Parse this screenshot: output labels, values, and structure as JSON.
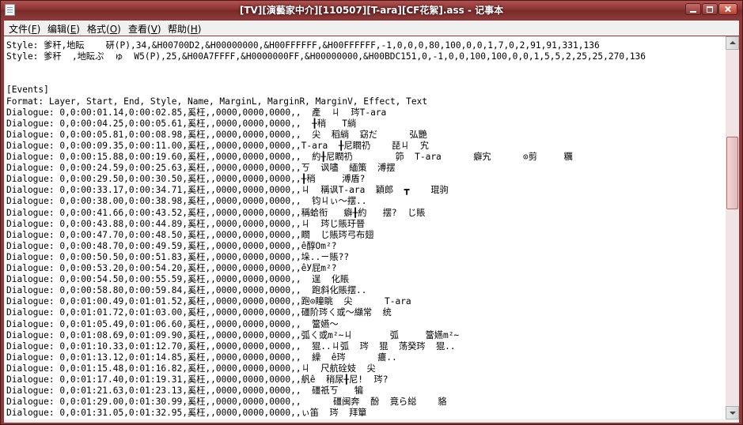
{
  "window": {
    "title": "[TV][演藝家中介][110507][T-ara][CF花絮].ass - 记事本"
  },
  "menu": [
    {
      "label": "文件(",
      "key": "F",
      "suffix": ")"
    },
    {
      "label": "编辑(",
      "key": "E",
      "suffix": ")"
    },
    {
      "label": "格式(",
      "key": "O",
      "suffix": ")"
    },
    {
      "label": "查看(",
      "key": "V",
      "suffix": ")"
    },
    {
      "label": "帮助(",
      "key": "H",
      "suffix": ")"
    }
  ],
  "editor": {
    "lines": [
      "Style: 爹秆,地眃    硏(P),34,&H00700D2,&H00000000,&H00FFFFFF,&H00FFFFFF,-1,0,0,0,80,100,0,0,1,7,0,2,91,91,331,136",
      "Style: 爹秆  ,地眃ぷ  ゅ  W5(P),25,&H00A7FFFF,&H0000000FF,&H00000000,&H00BDC151,0,-1,0,0,100,100,0,0,1,5,5,2,25,25,270,136",
      "",
      "",
      "[Events]",
      "Format: Layer, Start, End, Style, Name, MarginL, MarginR, MarginV, Effect, Text",
      "Dialogue: 0,0:00:01.14,0:00:02.85,奚枉,,0000,0000,0000,,  產  ㄐ  琌T-ara",
      "Dialogue: 0,0:00:04.25,0:00:05.61,奚枉,,0000,0000,0000,,  ╂稍   T緔",
      "Dialogue: 0,0:00:05.81,0:00:08.98,奚枉,,0000,0000,0000,,  尖  稻緔  窈だ      弘艷",
      "Dialogue: 0,0:00:09.35,0:00:11.00,奚枉,,0000,0000,0000,,T-ara  ╂尼瞤礽    琵ㄐ  宄",
      "Dialogue: 0,0:00:15.88,0:00:19.60,奚枉,,0000,0000,0000,,  約╂尼瞤礽        笷  T-ara      癖宄      ⊙剪     糲",
      "Dialogue: 0,0:00:24.59,0:00:25.63,奚枉,,0000,0000,0000,,ㄎ  讽嚍  緬策  溥摆",
      "Dialogue: 0,0:00:29.50,0:00:30.50,奚枉,,0000,0000,0000,,╂稍     溥盾?",
      "Dialogue: 0,0:00:33.17,0:00:34.71,奚枉,,0000,0000,0000,,ㄐ  稱讽T-ara  穎郎  ┳    琨驹",
      "Dialogue: 0,0:00:38.00,0:00:38.98,奚枉,,0000,0000,0000,,  钧ㄐぃ〜摆..",
      "Dialogue: 0,0:00:41.66,0:00:43.52,奚枉,,0000,0000,0000,,稱蛤衔   癖╂約   摆?  じ賬",
      "Dialogue: 0,0:00:43.88,0:00:44.89,奚枉,,0000,0000,0000,,ㄐ  琌じ賬玗晉",
      "Dialogue: 0,0:00:47.70,0:00:48.50,奚枉,,0000,0000,0000,,瞤  じ賬琌弓布翅",
      "Dialogue: 0,0:00:48.70,0:00:49.59,奚枉,,0000,0000,0000,,ê醇Om²?",
      "Dialogue: 0,0:00:50.50,0:00:51.83,奚枉,,0000,0000,0000,,垛..ㄧ賬??",
      "Dialogue: 0,0:00:53.20,0:00:54.20,奚枉,,0000,0000,0000,,êУ屁m²?",
      "Dialogue: 0,0:00:54.50,0:00:55.59,奚枉,,0000,0000,0000,,  逞  化賬",
      "Dialogue: 0,0:00:58.80,0:00:59.84,奚枉,,0000,0000,0000,,  跑斜化賬摆..",
      "Dialogue: 0,0:01:00.49,0:01:01.52,奚枉,,0000,0000,0000,,跑⊙瞳眺  尖      T-ara",
      "Dialogue: 0,0:01:01.72,0:01:03.00,奚枉,,0000,0000,0000,,礓阶琌ㄑ或〜纈常  统",
      "Dialogue: 0,0:01:05.49,0:01:06.60,奚枉,,0000,0000,0000,,  簹嬿〜",
      "Dialogue: 0,0:01:08.69,0:01:09.90,奚枉,,0000,0000,0000,,弧ㄑ或m²~ㄐ       弧     簹嬿m²~",
      "Dialogue: 0,0:01:10.33,0:01:12.70,奚枉,,0000,0000,0000,,  猑..ㄐ弧  琌  猑  荡癸琌  猑..",
      "Dialogue: 0,0:01:13.12,0:01:14.85,奚枉,,0000,0000,0000,,  繰  ê琌      癑..",
      "Dialogue: 0,0:01:15.48,0:01:16.82,奚枉,,0000,0000,0000,,ㄐ  尺航硂妓  尖",
      "Dialogue: 0,0:01:17.40,0:01:19.31,奚枉,,0000,0000,0000,,舤ê  稍尿╂尼!  琌?",
      "Dialogue: 0,0:01:21.63,0:01:23.13,奚枉,,0000,0000,0000,,  礓祇ㄎ   犏",
      "Dialogue: 0,0:01:29.00,0:01:30.99,奚枉,,0000,0000,0000,,      礓闽奔  酚  竟ら縂    貉",
      "Dialogue: 0,0:01:31.05,0:01:32.95,奚枉,,0000,0000,0000,,ぃ笛  琌  拜簞"
    ]
  }
}
